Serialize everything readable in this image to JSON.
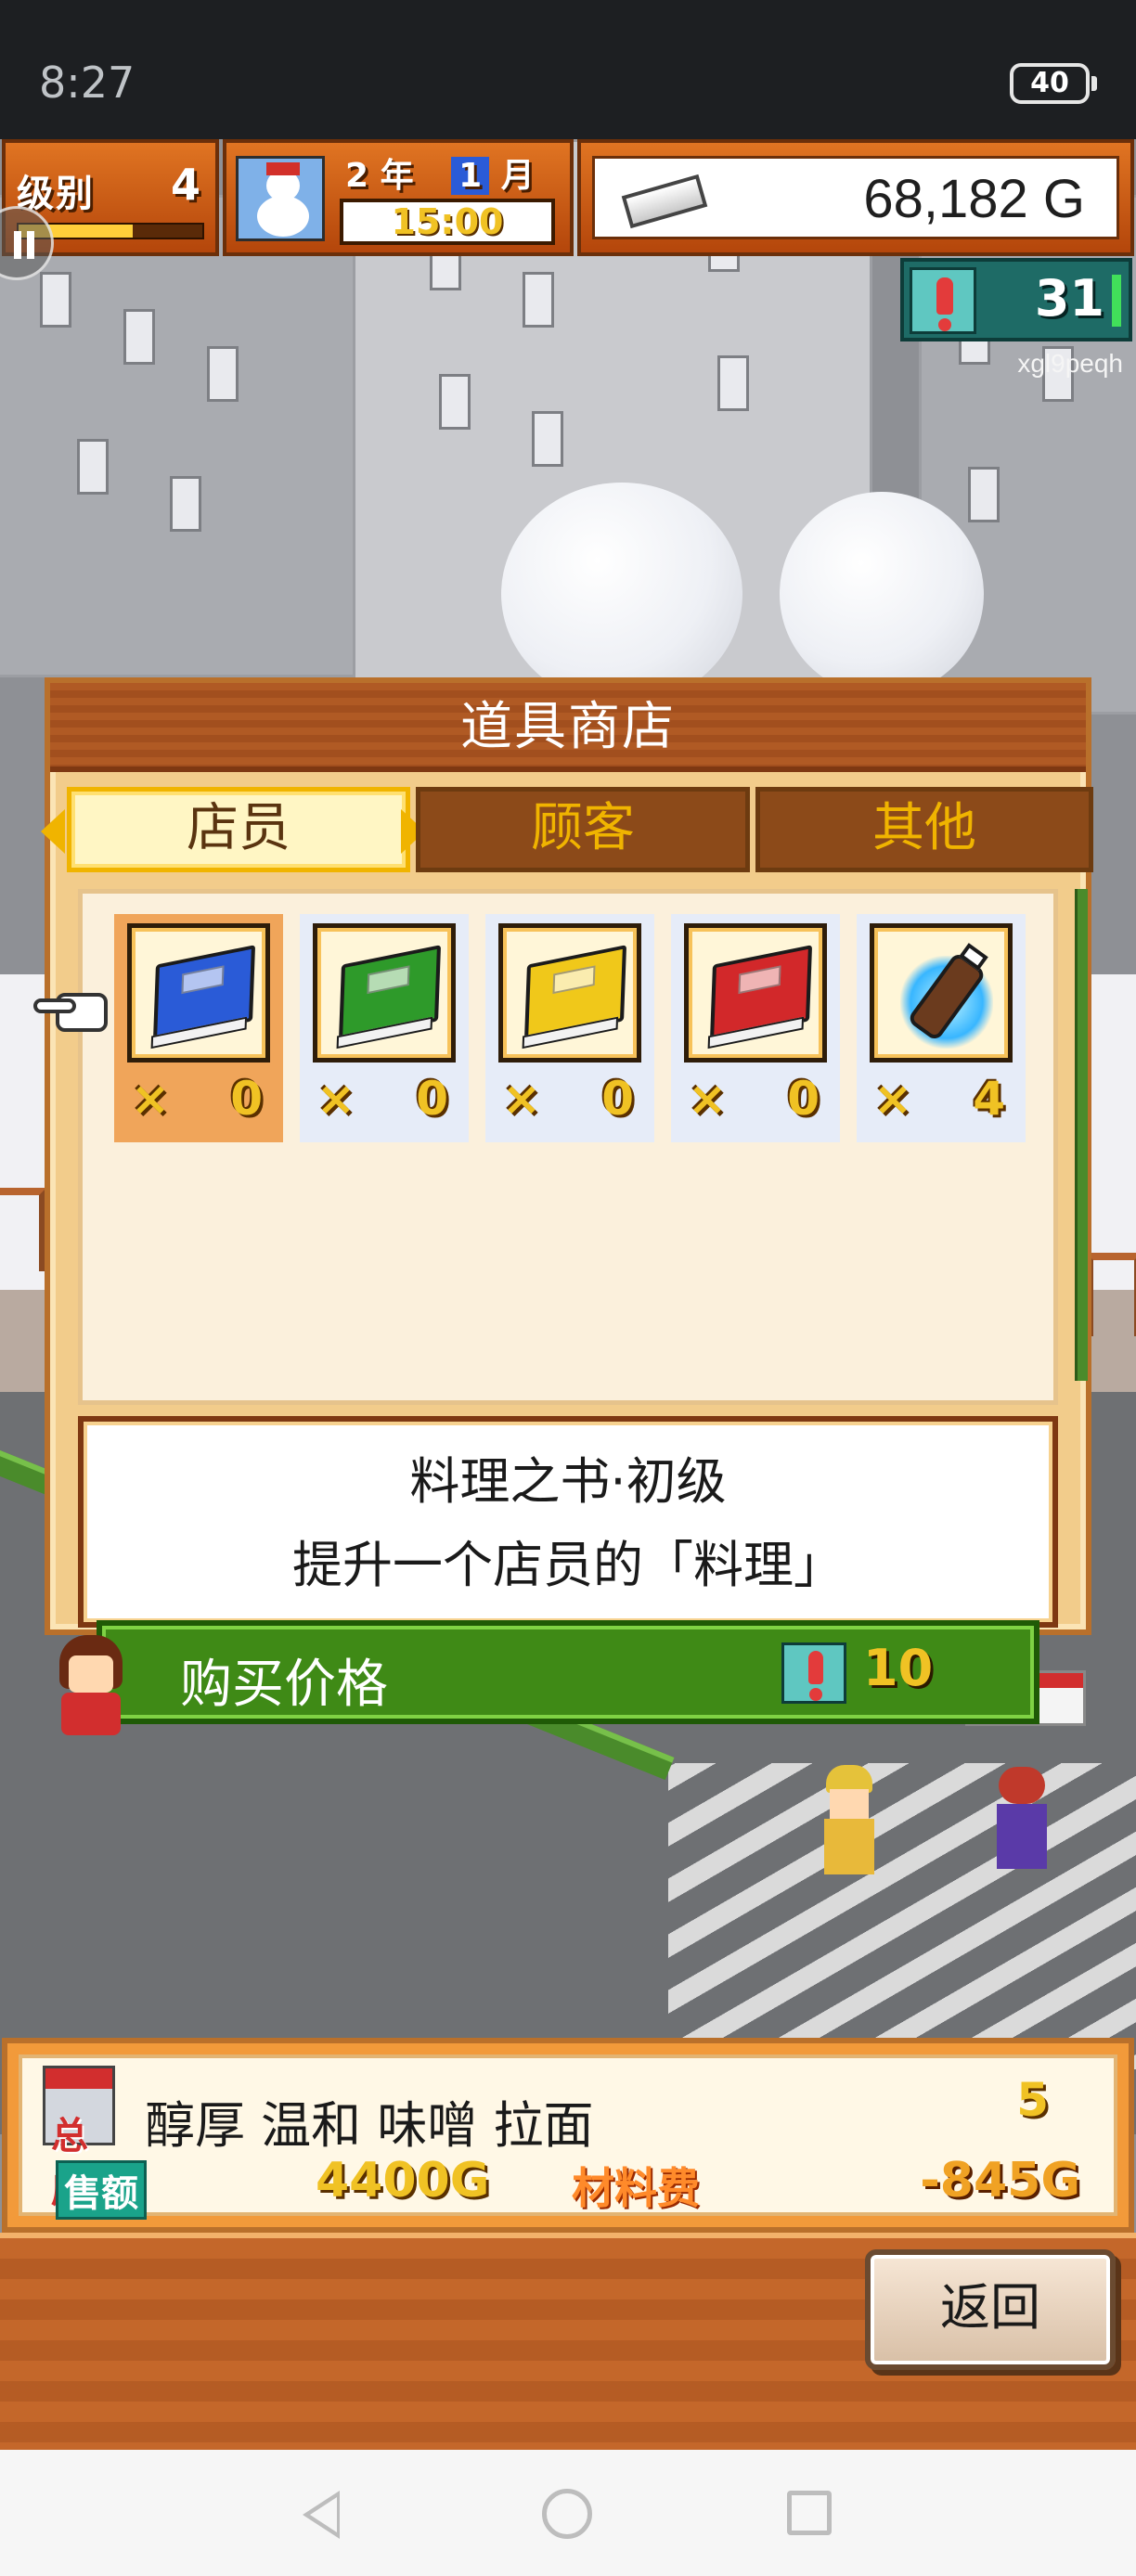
{
  "status_bar": {
    "time": "8:27",
    "battery": "40"
  },
  "hud": {
    "level_label": "级别",
    "level_value": "4",
    "level_progress": 0.62,
    "year": "2",
    "year_unit": "年",
    "month": "1",
    "month_unit": "月",
    "clock": "15:00",
    "money": "68,182 G",
    "points": "31",
    "player_id": "xgl9peqh"
  },
  "shop": {
    "title": "道具商店",
    "tabs": [
      {
        "label": "店员",
        "active": true
      },
      {
        "label": "顾客",
        "active": false
      },
      {
        "label": "其他",
        "active": false
      }
    ],
    "items": [
      {
        "icon": "blue-cookbook-icon",
        "color": "#2a5bd7",
        "count_prefix": "×",
        "count": "0",
        "selected": true
      },
      {
        "icon": "green-cookbook-icon",
        "color": "#2e9a2a",
        "count_prefix": "×",
        "count": "0",
        "selected": false
      },
      {
        "icon": "yellow-cookbook-icon",
        "color": "#f0c81a",
        "count_prefix": "×",
        "count": "0",
        "selected": false
      },
      {
        "icon": "red-cookbook-icon",
        "color": "#d2282a",
        "count_prefix": "×",
        "count": "0",
        "selected": false
      },
      {
        "icon": "energy-drink-icon",
        "color": "#38b6ff",
        "count_prefix": "×",
        "count": "4",
        "selected": false
      }
    ],
    "description": {
      "line1": "料理之书·初级",
      "line2": "提升一个店员的「料理」"
    },
    "price_label": "购买价格",
    "price_value": "10"
  },
  "store": {
    "badge": "总店",
    "name": "醇厚 温和 味噌 拉面",
    "rank": "5",
    "sales_label": "售额",
    "sales_value": "4400G",
    "cost_label": "材料费",
    "cost_value": "-845G"
  },
  "back_button": "返回",
  "colors": {
    "hud_orange": "#e07422",
    "dialog_bg": "#f2cc8b",
    "price_green": "#3f8a16",
    "accent_gold": "#f0c224"
  }
}
